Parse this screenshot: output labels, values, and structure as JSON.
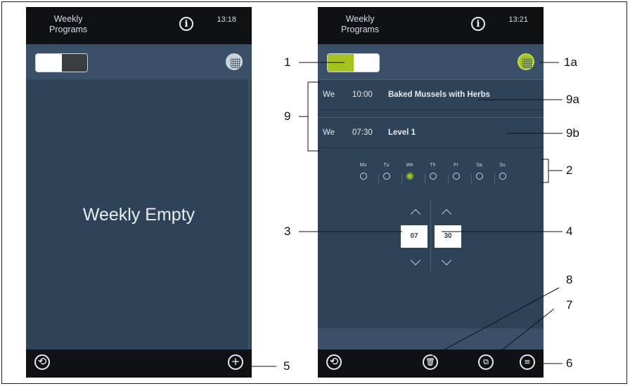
{
  "left_screen": {
    "header": {
      "title_line1": "Weekly",
      "title_line2": "Programs",
      "time": "13:18",
      "info_icon": "info-icon"
    },
    "toggle_state": "off",
    "calendar_icon": "calendar-icon",
    "empty_message": "Weekly Empty",
    "bottom_bar": {
      "back_icon": "back-icon",
      "add_icon": "add-icon",
      "add_symbol": "+"
    }
  },
  "right_screen": {
    "header": {
      "title_line1": "Weekly",
      "title_line2": "Programs",
      "time": "13:21",
      "info_icon": "info-icon"
    },
    "toggle_state": "on",
    "calendar_icon": "calendar-icon",
    "programs": [
      {
        "day": "We",
        "time": "10:00",
        "name": "Baked Mussels with Herbs"
      },
      {
        "day": "We",
        "time": "07:30",
        "name": "Level 1"
      }
    ],
    "weekdays": [
      {
        "label": "Mo",
        "selected": false
      },
      {
        "label": "Tu",
        "selected": false
      },
      {
        "label": "We",
        "selected": true
      },
      {
        "label": "Th",
        "selected": false
      },
      {
        "label": "Fr",
        "selected": false
      },
      {
        "label": "Sa",
        "selected": false
      },
      {
        "label": "Su",
        "selected": false
      }
    ],
    "time_picker": {
      "hours": "07",
      "minutes": "30"
    },
    "bottom_bar": {
      "back_icon": "back-icon",
      "delete_icon": "trash-icon",
      "copy_icon": "copy-icon",
      "list_icon": "list-icon"
    }
  },
  "colors": {
    "accent_green": "#a6c21f",
    "panel_blue": "#2f4358",
    "bar_black": "#0f1114"
  },
  "callouts": {
    "c1": "1",
    "c1a": "1a",
    "c2": "2",
    "c3": "3",
    "c4": "4",
    "c5": "5",
    "c6": "6",
    "c7": "7",
    "c8": "8",
    "c9": "9",
    "c9a": "9a",
    "c9b": "9b"
  }
}
